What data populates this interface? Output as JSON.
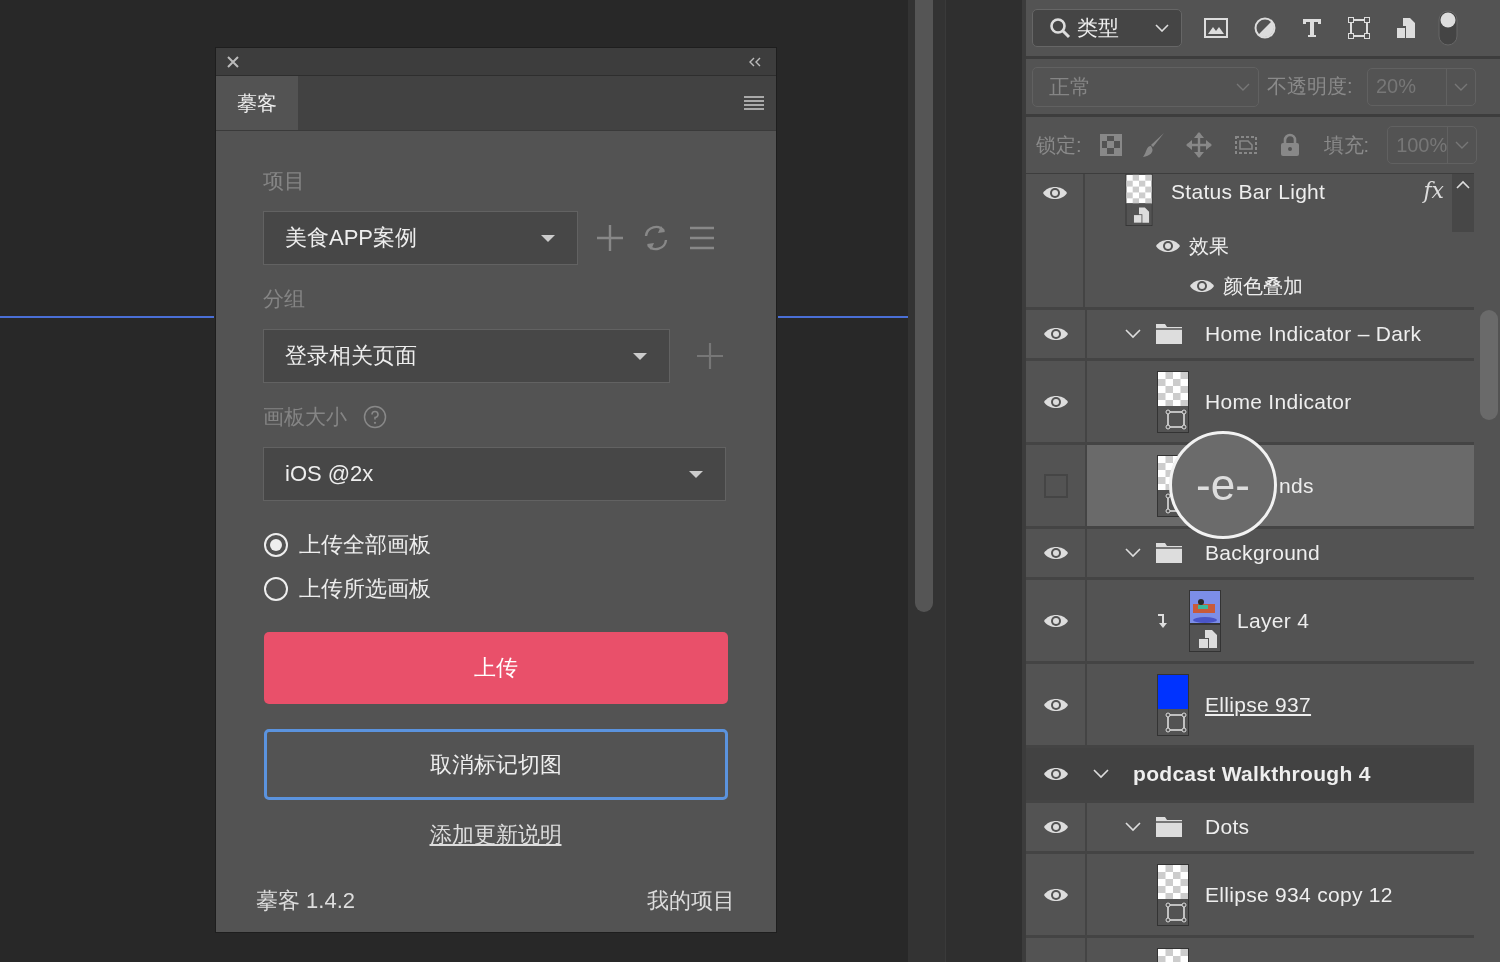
{
  "plugin_panel": {
    "tab": {
      "label": "摹客",
      "selected": true
    },
    "project": {
      "label": "项目",
      "value": "美食APP案例"
    },
    "group": {
      "label": "分组",
      "value": "登录相关页面"
    },
    "artboard_size": {
      "label": "画板大小",
      "value": "iOS @2x"
    },
    "upload_options": [
      {
        "label": "上传全部画板",
        "selected": true
      },
      {
        "label": "上传所选画板",
        "selected": false
      }
    ],
    "upload_button": "上传",
    "unmark_button": "取消标记切图",
    "notes_link": "添加更新说明",
    "footer": {
      "version": "摹客 1.4.2",
      "my_projects": "我的项目"
    }
  },
  "layers_panel": {
    "filter": {
      "value": "类型",
      "on": true
    },
    "blend": {
      "value": "正常",
      "disabled": true
    },
    "opacity": {
      "label": "不透明度:",
      "value": "20%",
      "disabled": true
    },
    "lock": {
      "label": "锁定:",
      "disabled": true
    },
    "fill": {
      "label": "填充:",
      "value": "100%",
      "disabled": true
    },
    "magnifier": {
      "text": "-e-"
    },
    "layers": [
      {
        "kind": "smart",
        "name": "Status Bar Light",
        "visible": true,
        "selected": false,
        "fx": "fx",
        "effects": {
          "label": "效果",
          "items": [
            "颜色叠加"
          ]
        }
      },
      {
        "kind": "group",
        "name": "Home Indicator – Dark",
        "visible": true,
        "selected": false,
        "expanded": true,
        "children": [
          {
            "kind": "shape",
            "name": "Home Indicator",
            "visible": true,
            "selected": false
          },
          {
            "kind": "shape",
            "name": "nds",
            "visible": false,
            "selected": true
          }
        ]
      },
      {
        "kind": "group",
        "name": "Background",
        "visible": true,
        "selected": false,
        "expanded": true,
        "children": [
          {
            "kind": "picture",
            "name": "Layer 4",
            "visible": true,
            "selected": false,
            "clipped": true
          },
          {
            "kind": "shape",
            "name": "Ellipse 937",
            "visible": true,
            "selected": false,
            "clip_base": true,
            "color": "#0033ff"
          }
        ]
      },
      {
        "kind": "artboard",
        "name": "podcast Walkthrough 4",
        "visible": true,
        "selected": false,
        "expanded": true,
        "children": [
          {
            "kind": "group",
            "name": "Dots",
            "visible": true,
            "selected": false,
            "expanded": true,
            "children": [
              {
                "kind": "shape",
                "name": "Ellipse 934 copy 12",
                "visible": true,
                "selected": false
              },
              {
                "kind": "shape",
                "selected": false
              }
            ]
          }
        ]
      }
    ]
  }
}
